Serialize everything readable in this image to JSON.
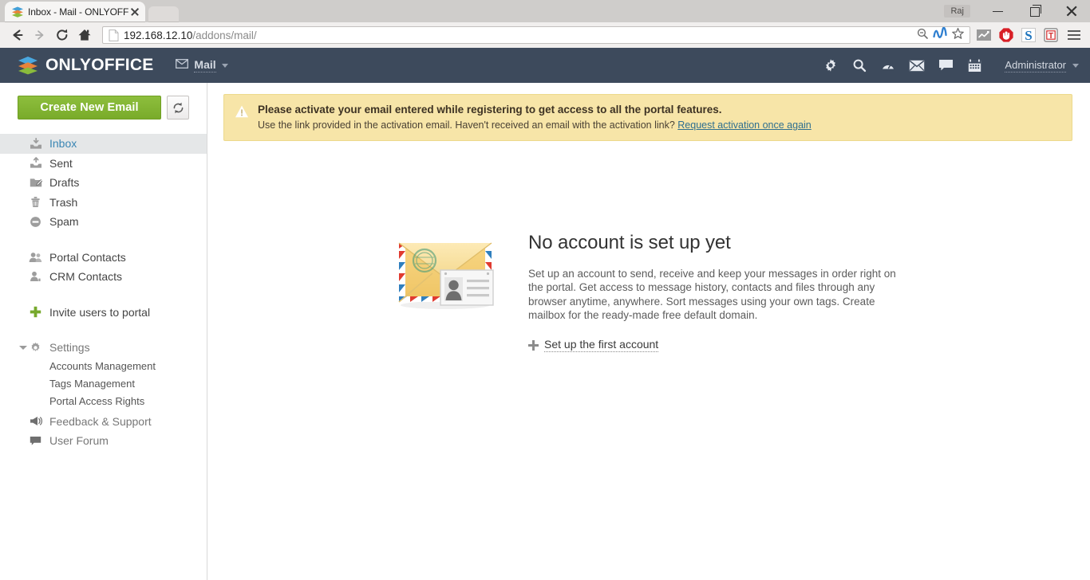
{
  "browser": {
    "tab": {
      "title": "Inbox - Mail - ONLYOFFIC",
      "favicon": "onlyoffice-layers-icon",
      "close": "close-icon"
    },
    "window": {
      "user_badge": "Raj",
      "minimize": "minimize-icon",
      "restore": "restore-icon",
      "close": "close-icon"
    },
    "nav": {
      "back": "back-arrow-icon",
      "forward": "forward-arrow-icon",
      "reload": "reload-icon",
      "home": "home-icon"
    },
    "url": {
      "host": "192.168.12.10",
      "path": "/addons/mail/",
      "page_icon": "document-icon"
    },
    "url_icons": [
      "zoom-out-icon",
      "nav-squiggle-icon",
      "bookmark-star-icon"
    ],
    "extensions": [
      "chart-extension-icon",
      "adblock-stop-icon",
      "skype-s-icon",
      "translate-t-icon"
    ],
    "menu": "hamburger-menu-icon"
  },
  "header": {
    "logo_text": "ONLYOFFICE",
    "module": "Mail",
    "module_icon": "envelope-icon",
    "icons": [
      "gear-icon",
      "search-icon",
      "feed-gauge-icon",
      "mail-icon",
      "chat-icon",
      "calendar-icon"
    ],
    "user": "Administrator"
  },
  "sidebar": {
    "create_label": "Create New Email",
    "refresh_icon": "refresh-icon",
    "folders": [
      {
        "label": "Inbox",
        "icon": "inbox-tray-icon",
        "active": true
      },
      {
        "label": "Sent",
        "icon": "sent-tray-icon",
        "active": false
      },
      {
        "label": "Drafts",
        "icon": "drafts-folder-icon",
        "active": false
      },
      {
        "label": "Trash",
        "icon": "trash-bin-icon",
        "active": false
      },
      {
        "label": "Spam",
        "icon": "spam-minus-icon",
        "active": false
      }
    ],
    "contacts": [
      {
        "label": "Portal Contacts",
        "icon": "people-icon"
      },
      {
        "label": "CRM Contacts",
        "icon": "crm-contact-icon"
      }
    ],
    "invite": {
      "label": "Invite users to portal",
      "icon": "plus-green-icon"
    },
    "settings": {
      "label": "Settings",
      "icon": "gear-icon",
      "collapse_icon": "triangle-down-icon"
    },
    "settings_items": [
      {
        "label": "Accounts Management"
      },
      {
        "label": "Tags Management"
      },
      {
        "label": "Portal Access Rights"
      }
    ],
    "support": [
      {
        "label": "Feedback & Support",
        "icon": "megaphone-icon"
      },
      {
        "label": "User Forum",
        "icon": "speech-bubble-icon"
      }
    ]
  },
  "banner": {
    "icon": "warning-triangle-icon",
    "title": "Please activate your email entered while registering to get access to all the portal features.",
    "text": "Use the link provided in the activation email. Haven't received an email with the activation link? ",
    "link": "Request activation once again"
  },
  "empty_state": {
    "image": "envelope-contact-card-illustration",
    "title": "No account is set up yet",
    "description": "Set up an account to send, receive and keep your messages in order right on the portal. Get access to message history, contacts and files through any browser anytime, anywhere. Sort messages using your own tags. Create mailbox for the ready-made free default domain.",
    "cta": "Set up the first account",
    "cta_icon": "plus-icon"
  },
  "colors": {
    "header_bg": "#3d4a5c",
    "accent_green": "#7fb02e",
    "banner_bg": "#f7e5a8",
    "link_blue": "#3a86b4",
    "active_bg": "#e5e7e8"
  }
}
